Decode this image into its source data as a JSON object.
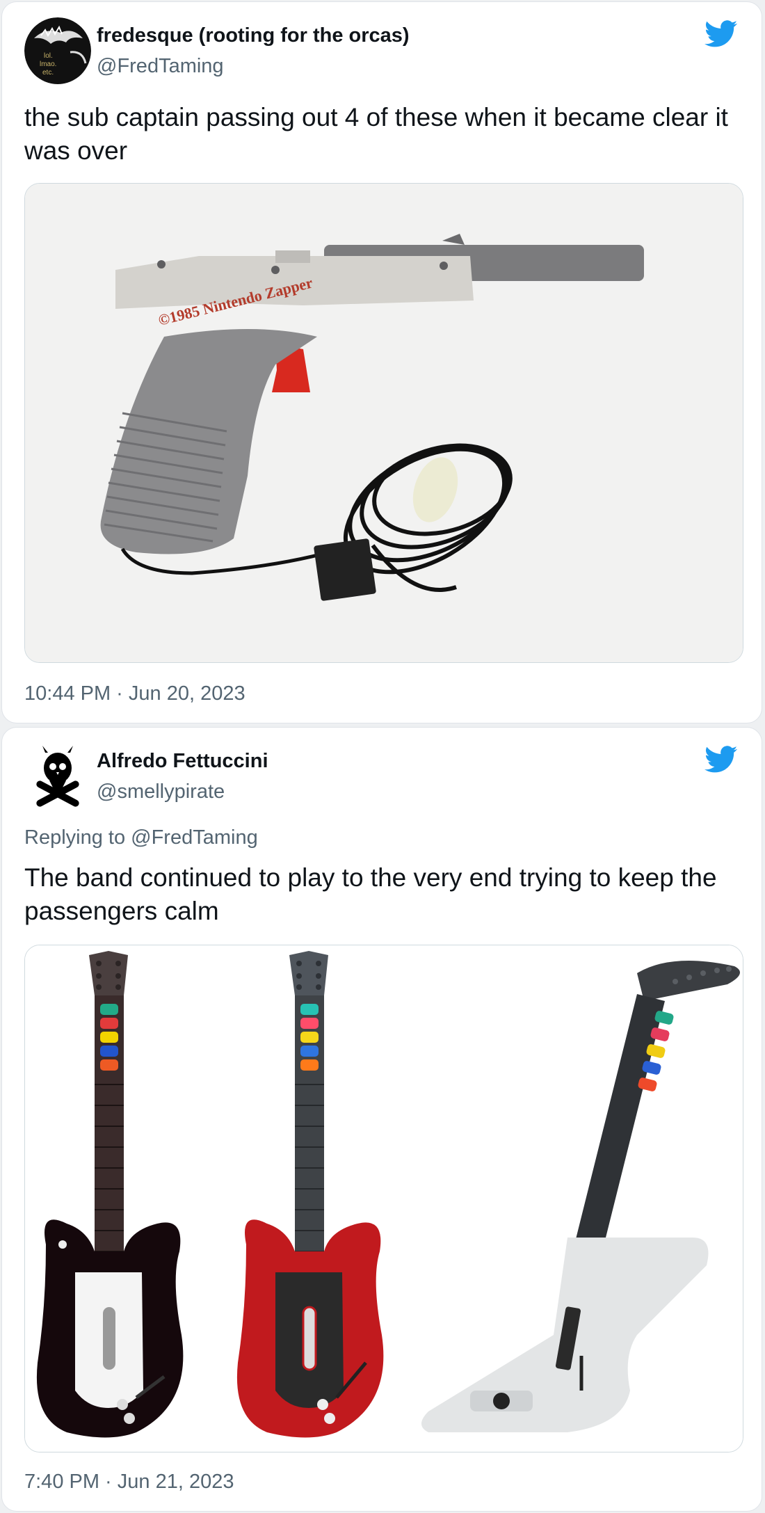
{
  "tweets": [
    {
      "display_name": "fredesque (rooting for the orcas)",
      "handle": "@FredTaming",
      "avatar_text": [
        "lol.",
        "lmao.",
        "etc."
      ],
      "text": "the sub captain passing out 4 of these when it became clear it was over",
      "media_label": "©1985 Nintendo Zapper",
      "timestamp": "10:44 PM · Jun 20, 2023",
      "icon": "twitter-bird-icon"
    },
    {
      "display_name": "Alfredo Fettuccini",
      "handle": "@smellypirate",
      "replying_prefix": "Replying to ",
      "replying_to": "@FredTaming",
      "text": "The band continued to play to the very end trying to keep the passengers calm",
      "timestamp": "7:40 PM · Jun 21, 2023",
      "icon": "twitter-bird-icon"
    }
  ],
  "colors": {
    "twitter_blue": "#1d9bf0",
    "secondary_text": "#536471",
    "primary_text": "#0f1419",
    "border": "#dfe3e8"
  }
}
